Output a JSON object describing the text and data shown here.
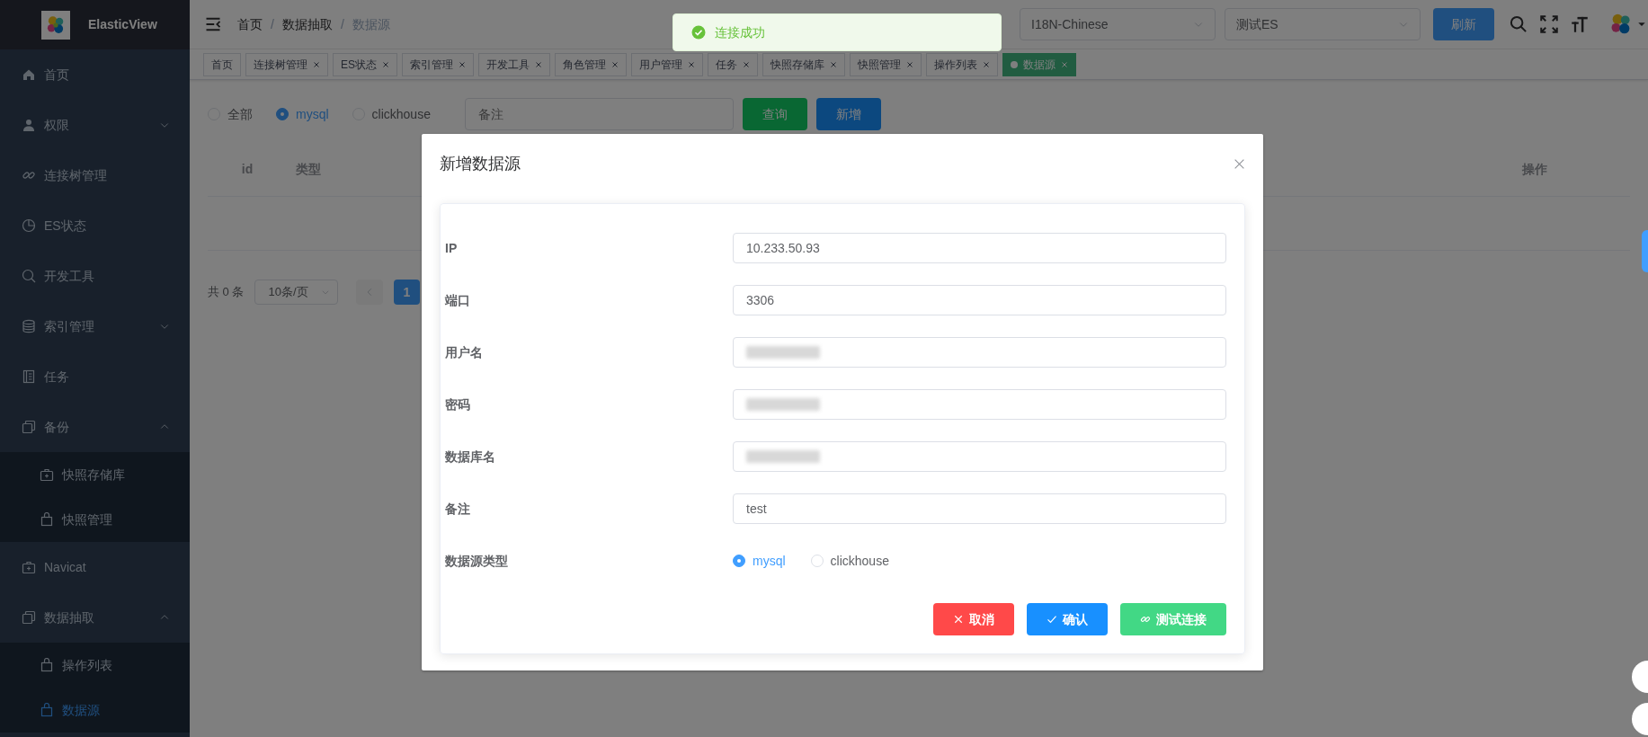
{
  "app": {
    "title": "ElasticView"
  },
  "sidebar": {
    "items": [
      {
        "label": "首页",
        "selected": false
      },
      {
        "label": "权限",
        "selected": false,
        "expanded": false
      },
      {
        "label": "连接树管理",
        "selected": false
      },
      {
        "label": "ES状态",
        "selected": false
      },
      {
        "label": "开发工具",
        "selected": false
      },
      {
        "label": "索引管理",
        "selected": false,
        "expanded": false
      },
      {
        "label": "任务",
        "selected": false
      },
      {
        "label": "备份",
        "selected": false,
        "expanded": true,
        "children": [
          {
            "label": "快照存储库",
            "selected": false
          },
          {
            "label": "快照管理",
            "selected": false
          }
        ]
      },
      {
        "label": "Navicat",
        "selected": false
      },
      {
        "label": "数据抽取",
        "selected": false,
        "expanded": true,
        "children": [
          {
            "label": "操作列表",
            "selected": false
          },
          {
            "label": "数据源",
            "selected": true
          }
        ]
      }
    ]
  },
  "breadcrumb": {
    "items": [
      "首页",
      "数据抽取",
      "数据源"
    ],
    "separators": [
      "/",
      "/"
    ]
  },
  "header": {
    "language": "I18N-Chinese",
    "connection": "测试ES",
    "refresh_button": "刷新"
  },
  "tags": [
    {
      "label": "首页",
      "selected": false,
      "closable": false
    },
    {
      "label": "连接树管理",
      "selected": false,
      "closable": true
    },
    {
      "label": "ES状态",
      "selected": false,
      "closable": true
    },
    {
      "label": "索引管理",
      "selected": false,
      "closable": true
    },
    {
      "label": "开发工具",
      "selected": false,
      "closable": true
    },
    {
      "label": "角色管理",
      "selected": false,
      "closable": true
    },
    {
      "label": "用户管理",
      "selected": false,
      "closable": true
    },
    {
      "label": "任务",
      "selected": false,
      "closable": true
    },
    {
      "label": "快照存储库",
      "selected": false,
      "closable": true
    },
    {
      "label": "快照管理",
      "selected": false,
      "closable": true
    },
    {
      "label": "操作列表",
      "selected": false,
      "closable": true
    },
    {
      "label": "数据源",
      "selected": true,
      "closable": true
    }
  ],
  "filter": {
    "types": [
      {
        "label": "全部",
        "selected": false
      },
      {
        "label": "mysql",
        "selected": true
      },
      {
        "label": "clickhouse",
        "selected": false
      }
    ],
    "search": {
      "placeholder": "备注"
    },
    "query_button": "查询",
    "add_button": "新增"
  },
  "table": {
    "columns": [
      "id",
      "类型",
      "操作"
    ]
  },
  "pagination": {
    "total": "共 0 条",
    "page_size": "10条/页",
    "current_page": "1"
  },
  "toast": {
    "message": "连接成功"
  },
  "modal": {
    "title": "新增数据源",
    "fields": [
      {
        "kind": "input",
        "label": "IP",
        "value": "10.233.50.93",
        "redacted": false
      },
      {
        "kind": "input",
        "label": "端口",
        "value": "3306",
        "redacted": false
      },
      {
        "kind": "input",
        "label": "用户名",
        "redacted": true
      },
      {
        "kind": "input",
        "label": "密码",
        "redacted": true
      },
      {
        "kind": "input",
        "label": "数据库名",
        "redacted": true
      },
      {
        "kind": "input",
        "label": "备注",
        "value": "test",
        "redacted": false
      },
      {
        "kind": "radio",
        "label": "数据源类型",
        "options": [
          {
            "label": "mysql",
            "selected": true
          },
          {
            "label": "clickhouse",
            "selected": false
          }
        ]
      }
    ],
    "buttons": [
      {
        "kind": "cancel",
        "label": "取消"
      },
      {
        "kind": "confirm",
        "label": "确认"
      },
      {
        "kind": "test",
        "label": "测试连接"
      }
    ]
  }
}
